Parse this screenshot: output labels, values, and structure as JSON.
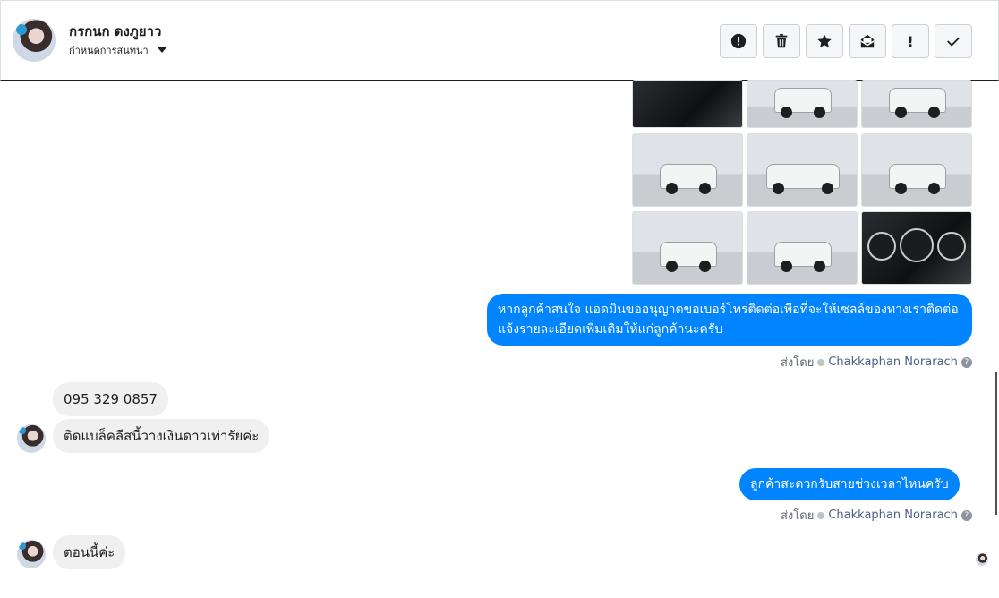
{
  "header": {
    "name": "กรกนก ดงภูยาว",
    "subtitle": "กำหนดการสนทนา",
    "tools": [
      {
        "icon": "alert-circle-icon",
        "name": "spam-button"
      },
      {
        "icon": "trash-icon",
        "name": "delete-button"
      },
      {
        "icon": "star-icon",
        "name": "star-button"
      },
      {
        "icon": "mark-unread-icon",
        "name": "mark-unread-button"
      },
      {
        "icon": "exclamation-icon",
        "name": "important-button"
      },
      {
        "icon": "check-icon",
        "name": "done-button"
      }
    ]
  },
  "messages": {
    "out1": "หากลูกค้าสนใจ แอดมินขออนุญาตขอเบอร์โทรติดต่อเพื่อที่จะให้เซลล์ของทางเราติดต่อแจ้งรายละเอียดเพิ่มเติมให้แก่ลูกค้านะครับ",
    "sent_by_prefix": "ส่งโดย",
    "sent_by_name": "Chakkaphan Norarach",
    "in1": "095 329 0857",
    "in2": "ติดแบล็คลีสนี้วางเงินดาวเท่ารัยค่ะ",
    "out2": "ลูกค้าสะดวกรับสายช่วงเวลาไหนครับ",
    "in3": "ตอนนี้ค่ะ"
  },
  "colors": {
    "outgoing": "#0084ff",
    "incoming": "#f1f0f0",
    "sender_name": "#4b5f86"
  }
}
